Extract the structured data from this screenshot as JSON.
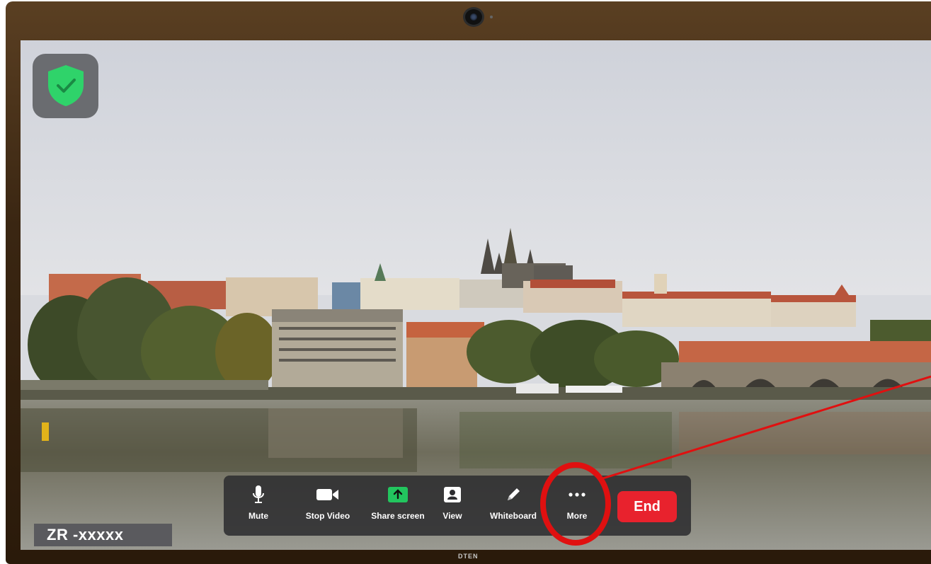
{
  "meeting": {
    "participant_name": "ZR -xxxxx",
    "encryption_icon": "shield-check-icon"
  },
  "toolbar": {
    "items": [
      {
        "label": "Mute",
        "icon": "microphone-icon"
      },
      {
        "label": "Stop Video",
        "icon": "video-camera-icon"
      },
      {
        "label": "Share screen",
        "icon": "share-screen-icon"
      },
      {
        "label": "View",
        "icon": "view-speaker-icon"
      },
      {
        "label": "Whiteboard",
        "icon": "pencil-icon"
      },
      {
        "label": "More",
        "icon": "more-dots-icon"
      }
    ],
    "end_label": "End"
  },
  "monitor": {
    "brand": "DTEN"
  },
  "colors": {
    "end_red": "#e8222d",
    "share_green": "#22c55e",
    "shield_green": "#2fd36a",
    "annotation_red": "#e01010"
  }
}
